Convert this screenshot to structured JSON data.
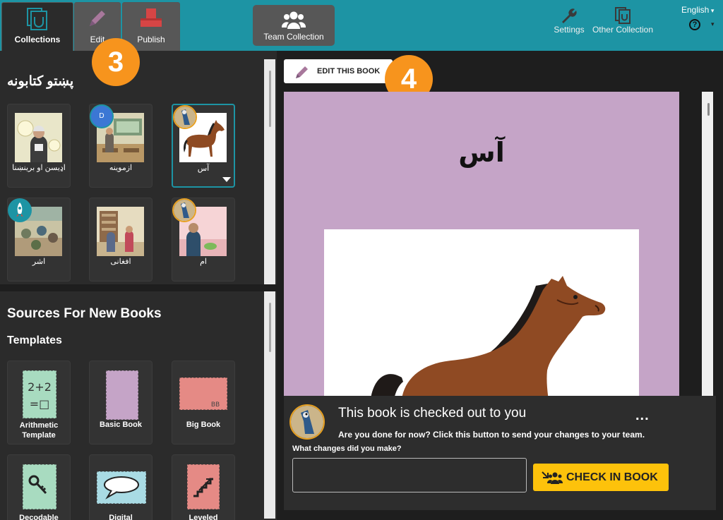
{
  "topbar": {
    "tabs": [
      {
        "label": "Collections"
      },
      {
        "label": "Edit"
      },
      {
        "label": "Publish"
      }
    ],
    "team_collection": "Team Collection",
    "settings": "Settings",
    "other_collection": "Other Collection",
    "language": "English",
    "help": "?"
  },
  "steps": {
    "edit_step": "3",
    "edit_book_step": "4"
  },
  "collection": {
    "title": "پښتو كتابونه",
    "books": [
      {
        "title": "اډیسن او برینښنا",
        "icon": "portrait-scientist-icon"
      },
      {
        "title": "ازموینه",
        "icon": "classroom-icon",
        "badge": "D"
      },
      {
        "title": "آس",
        "icon": "horse-icon",
        "selected": true
      },
      {
        "title": "اشر",
        "icon": "village-work-icon",
        "badge_icon": "rocket-icon"
      },
      {
        "title": "افغانی",
        "icon": "shop-icon"
      },
      {
        "title": "ام",
        "icon": "mango-icon"
      }
    ]
  },
  "sources": {
    "title": "Sources For New Books",
    "templates_label": "Templates",
    "templates": [
      {
        "title": "Arithmetic Template",
        "icon": "arithmetic-icon"
      },
      {
        "title": "Basic Book",
        "icon": "basic-book-icon"
      },
      {
        "title": "Big Book",
        "icon": "big-book-icon"
      },
      {
        "title": "Decodable",
        "icon": "keys-icon"
      },
      {
        "title": "Digital",
        "icon": "speech-bubble-icon"
      },
      {
        "title": "Leveled",
        "icon": "stairs-icon"
      }
    ]
  },
  "preview": {
    "edit_button": "EDIT THIS BOOK",
    "page_title": "آس",
    "checkout": {
      "title": "This book is checked out to you",
      "more": "...",
      "text": "Are you done for now? Click this button to send your changes to your team.",
      "changes_label": "What changes did you make?",
      "changes_value": "",
      "checkin_button": "CHECK IN BOOK"
    }
  },
  "colors": {
    "teal": "#1d94a4",
    "orange": "#f7941d",
    "yellow": "#fdc20b",
    "page": "#c5a4c7"
  }
}
